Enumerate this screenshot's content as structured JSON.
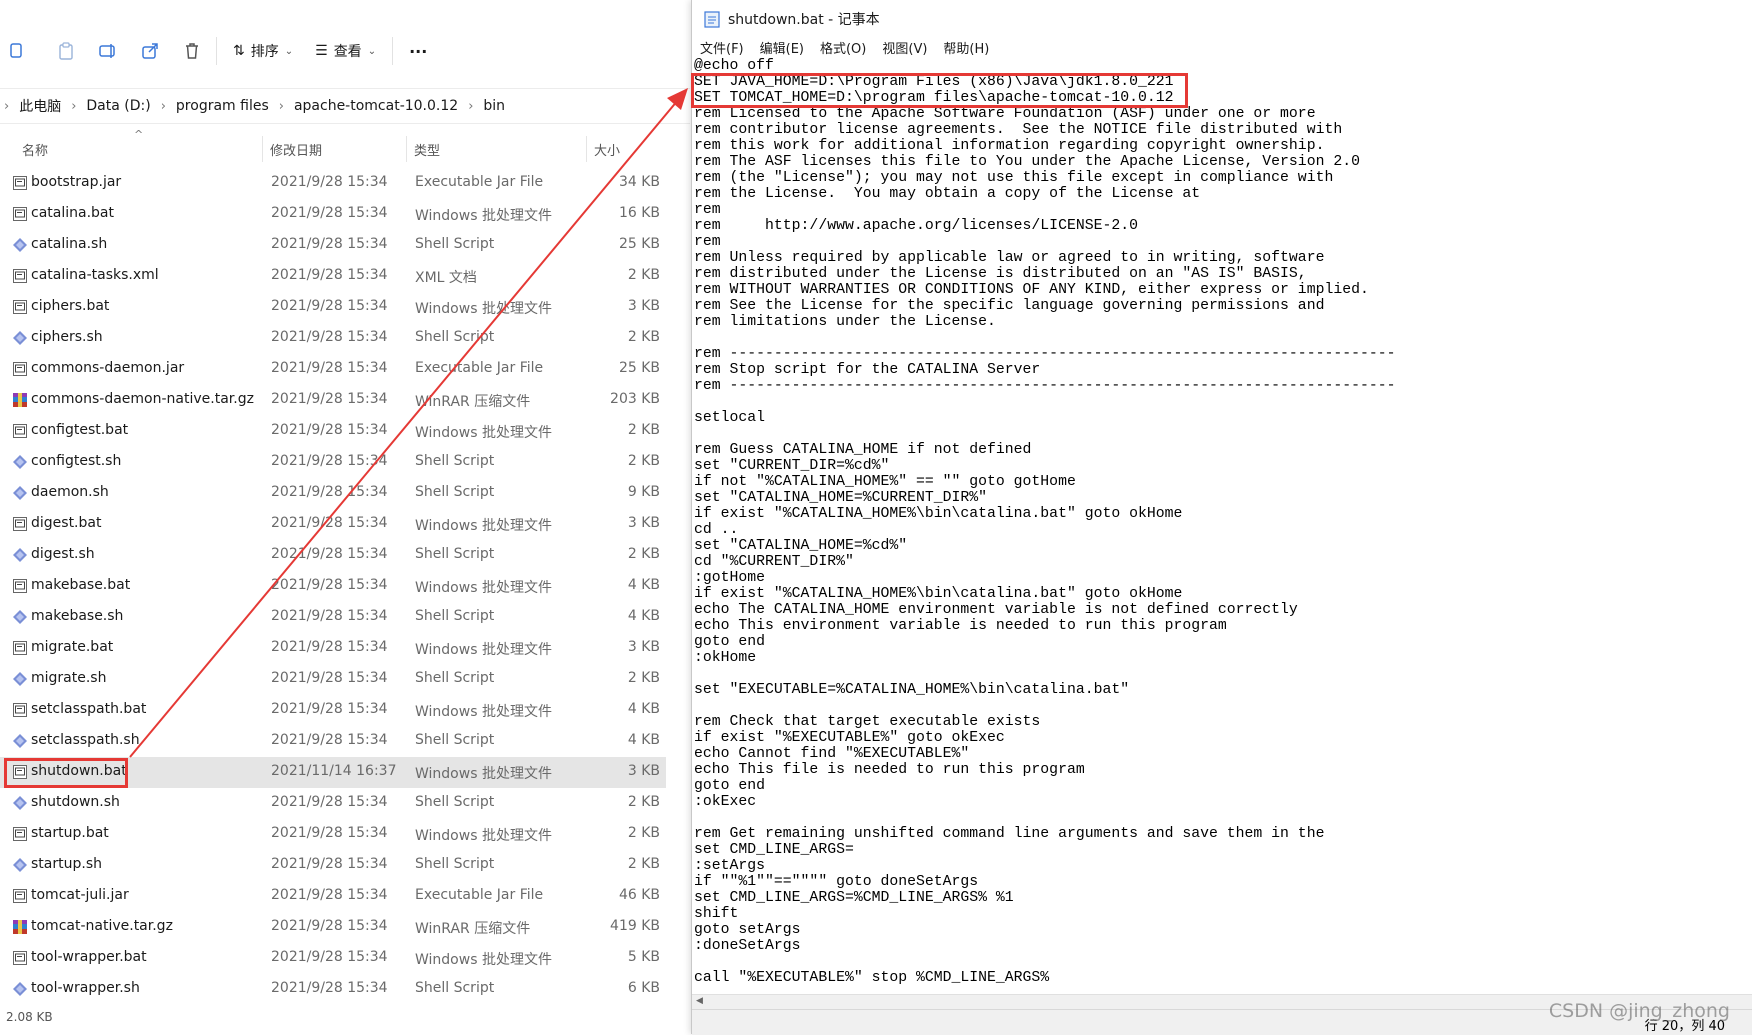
{
  "explorer": {
    "toolbar": {
      "sort_label": "排序",
      "view_label": "查看",
      "more_label": "···"
    },
    "address": {
      "crumbs": [
        "此电脑",
        "Data (D:)",
        "program files",
        "apache-tomcat-10.0.12",
        "bin"
      ]
    },
    "columns": {
      "name": "名称",
      "date": "修改日期",
      "type": "类型",
      "size": "大小"
    },
    "files": [
      {
        "name": "bootstrap.jar",
        "date": "2021/9/28 15:34",
        "type": "Executable Jar File",
        "size": "34 KB",
        "icon": "jar-file-icon"
      },
      {
        "name": "catalina.bat",
        "date": "2021/9/28 15:34",
        "type": "Windows 批处理文件",
        "size": "16 KB",
        "icon": "bat-file-icon"
      },
      {
        "name": "catalina.sh",
        "date": "2021/9/28 15:34",
        "type": "Shell Script",
        "size": "25 KB",
        "icon": "shell-script-icon"
      },
      {
        "name": "catalina-tasks.xml",
        "date": "2021/9/28 15:34",
        "type": "XML 文档",
        "size": "2 KB",
        "icon": "xml-file-icon"
      },
      {
        "name": "ciphers.bat",
        "date": "2021/9/28 15:34",
        "type": "Windows 批处理文件",
        "size": "3 KB",
        "icon": "bat-file-icon"
      },
      {
        "name": "ciphers.sh",
        "date": "2021/9/28 15:34",
        "type": "Shell Script",
        "size": "2 KB",
        "icon": "shell-script-icon"
      },
      {
        "name": "commons-daemon.jar",
        "date": "2021/9/28 15:34",
        "type": "Executable Jar File",
        "size": "25 KB",
        "icon": "jar-file-icon"
      },
      {
        "name": "commons-daemon-native.tar.gz",
        "date": "2021/9/28 15:34",
        "type": "WinRAR 压缩文件",
        "size": "203 KB",
        "icon": "winrar-archive-icon"
      },
      {
        "name": "configtest.bat",
        "date": "2021/9/28 15:34",
        "type": "Windows 批处理文件",
        "size": "2 KB",
        "icon": "bat-file-icon"
      },
      {
        "name": "configtest.sh",
        "date": "2021/9/28 15:34",
        "type": "Shell Script",
        "size": "2 KB",
        "icon": "shell-script-icon"
      },
      {
        "name": "daemon.sh",
        "date": "2021/9/28 15:34",
        "type": "Shell Script",
        "size": "9 KB",
        "icon": "shell-script-icon"
      },
      {
        "name": "digest.bat",
        "date": "2021/9/28 15:34",
        "type": "Windows 批处理文件",
        "size": "3 KB",
        "icon": "bat-file-icon"
      },
      {
        "name": "digest.sh",
        "date": "2021/9/28 15:34",
        "type": "Shell Script",
        "size": "2 KB",
        "icon": "shell-script-icon"
      },
      {
        "name": "makebase.bat",
        "date": "2021/9/28 15:34",
        "type": "Windows 批处理文件",
        "size": "4 KB",
        "icon": "bat-file-icon"
      },
      {
        "name": "makebase.sh",
        "date": "2021/9/28 15:34",
        "type": "Shell Script",
        "size": "4 KB",
        "icon": "shell-script-icon"
      },
      {
        "name": "migrate.bat",
        "date": "2021/9/28 15:34",
        "type": "Windows 批处理文件",
        "size": "3 KB",
        "icon": "bat-file-icon"
      },
      {
        "name": "migrate.sh",
        "date": "2021/9/28 15:34",
        "type": "Shell Script",
        "size": "2 KB",
        "icon": "shell-script-icon"
      },
      {
        "name": "setclasspath.bat",
        "date": "2021/9/28 15:34",
        "type": "Windows 批处理文件",
        "size": "4 KB",
        "icon": "bat-file-icon"
      },
      {
        "name": "setclasspath.sh",
        "date": "2021/9/28 15:34",
        "type": "Shell Script",
        "size": "4 KB",
        "icon": "shell-script-icon"
      },
      {
        "name": "shutdown.bat",
        "date": "2021/11/14 16:37",
        "type": "Windows 批处理文件",
        "size": "3 KB",
        "icon": "bat-file-icon",
        "selected": true
      },
      {
        "name": "shutdown.sh",
        "date": "2021/9/28 15:34",
        "type": "Shell Script",
        "size": "2 KB",
        "icon": "shell-script-icon"
      },
      {
        "name": "startup.bat",
        "date": "2021/9/28 15:34",
        "type": "Windows 批处理文件",
        "size": "2 KB",
        "icon": "bat-file-icon"
      },
      {
        "name": "startup.sh",
        "date": "2021/9/28 15:34",
        "type": "Shell Script",
        "size": "2 KB",
        "icon": "shell-script-icon"
      },
      {
        "name": "tomcat-juli.jar",
        "date": "2021/9/28 15:34",
        "type": "Executable Jar File",
        "size": "46 KB",
        "icon": "jar-file-icon"
      },
      {
        "name": "tomcat-native.tar.gz",
        "date": "2021/9/28 15:34",
        "type": "WinRAR 压缩文件",
        "size": "419 KB",
        "icon": "winrar-archive-icon"
      },
      {
        "name": "tool-wrapper.bat",
        "date": "2021/9/28 15:34",
        "type": "Windows 批处理文件",
        "size": "5 KB",
        "icon": "bat-file-icon"
      },
      {
        "name": "tool-wrapper.sh",
        "date": "2021/9/28 15:34",
        "type": "Shell Script",
        "size": "6 KB",
        "icon": "shell-script-icon"
      }
    ],
    "status": "2.08 KB"
  },
  "notepad": {
    "title": "shutdown.bat - 记事本",
    "menu": [
      "文件(F)",
      "编辑(E)",
      "格式(O)",
      "视图(V)",
      "帮助(H)"
    ],
    "lines": [
      "@echo off",
      "SET JAVA_HOME=D:\\Program Files (x86)\\Java\\jdk1.8.0_221",
      "SET TOMCAT_HOME=D:\\program files\\apache-tomcat-10.0.12",
      "rem Licensed to the Apache Software Foundation (ASF) under one or more",
      "rem contributor license agreements.  See the NOTICE file distributed with",
      "rem this work for additional information regarding copyright ownership.",
      "rem The ASF licenses this file to You under the Apache License, Version 2.0",
      "rem (the \"License\"); you may not use this file except in compliance with",
      "rem the License.  You may obtain a copy of the License at",
      "rem",
      "rem     http://www.apache.org/licenses/LICENSE-2.0",
      "rem",
      "rem Unless required by applicable law or agreed to in writing, software",
      "rem distributed under the License is distributed on an \"AS IS\" BASIS,",
      "rem WITHOUT WARRANTIES OR CONDITIONS OF ANY KIND, either express or implied.",
      "rem See the License for the specific language governing permissions and",
      "rem limitations under the License.",
      "",
      "rem ---------------------------------------------------------------------------",
      "rem Stop script for the CATALINA Server",
      "rem ---------------------------------------------------------------------------",
      "",
      "setlocal",
      "",
      "rem Guess CATALINA_HOME if not defined",
      "set \"CURRENT_DIR=%cd%\"",
      "if not \"%CATALINA_HOME%\" == \"\" goto gotHome",
      "set \"CATALINA_HOME=%CURRENT_DIR%\"",
      "if exist \"%CATALINA_HOME%\\bin\\catalina.bat\" goto okHome",
      "cd ..",
      "set \"CATALINA_HOME=%cd%\"",
      "cd \"%CURRENT_DIR%\"",
      ":gotHome",
      "if exist \"%CATALINA_HOME%\\bin\\catalina.bat\" goto okHome",
      "echo The CATALINA_HOME environment variable is not defined correctly",
      "echo This environment variable is needed to run this program",
      "goto end",
      ":okHome",
      "",
      "set \"EXECUTABLE=%CATALINA_HOME%\\bin\\catalina.bat\"",
      "",
      "rem Check that target executable exists",
      "if exist \"%EXECUTABLE%\" goto okExec",
      "echo Cannot find \"%EXECUTABLE%\"",
      "echo This file is needed to run this program",
      "goto end",
      ":okExec",
      "",
      "rem Get remaining unshifted command line arguments and save them in the",
      "set CMD_LINE_ARGS=",
      ":setArgs",
      "if \"\"%1\"\"==\"\"\"\" goto doneSetArgs",
      "set CMD_LINE_ARGS=%CMD_LINE_ARGS% %1",
      "shift",
      "goto setArgs",
      ":doneSetArgs",
      "",
      "call \"%EXECUTABLE%\" stop %CMD_LINE_ARGS%"
    ],
    "status_position": "行 20，列 40"
  },
  "watermark": "CSDN @jing_zhong",
  "annotation_color": "#e53935"
}
